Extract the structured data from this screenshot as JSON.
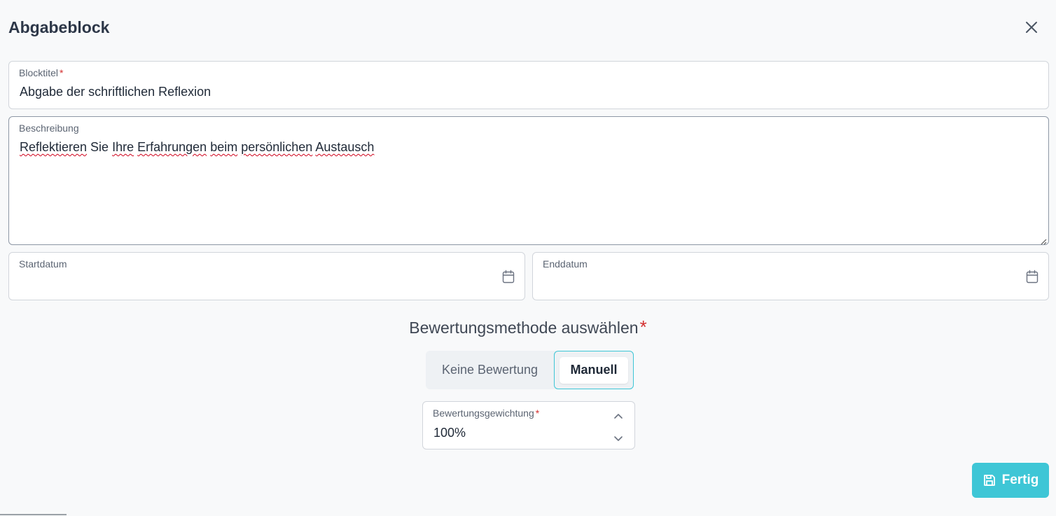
{
  "dialog": {
    "title": "Abgabeblock"
  },
  "fields": {
    "block_title": {
      "label": "Blocktitel",
      "required_mark": "*",
      "value": "Abgabe der schriftlichen Reflexion"
    },
    "description": {
      "label": "Beschreibung",
      "value_parts": [
        "Reflektieren",
        " Sie ",
        "Ihre",
        " ",
        "Erfahrungen",
        " ",
        "beim",
        " ",
        "persönlichen",
        " ",
        "Austausch"
      ]
    },
    "start_date": {
      "label": "Startdatum",
      "value": ""
    },
    "end_date": {
      "label": "Enddatum",
      "value": ""
    },
    "weighting": {
      "label": "Bewertungsgewichtung",
      "required_mark": "*",
      "value": "100%"
    }
  },
  "grading": {
    "heading": "Bewertungsmethode auswählen",
    "required_mark": "*",
    "options": [
      "Keine Bewertung",
      "Manuell"
    ],
    "selected": "Manuell"
  },
  "actions": {
    "done_label": "Fertig"
  },
  "colors": {
    "accent": "#3ec6d6",
    "required": "#d32f2f",
    "background": "#f8f9fa"
  },
  "icons": {
    "close": "close-icon",
    "calendar": "calendar-icon",
    "save": "save-icon",
    "chevron_up": "chevron-up-icon",
    "chevron_down": "chevron-down-icon"
  }
}
